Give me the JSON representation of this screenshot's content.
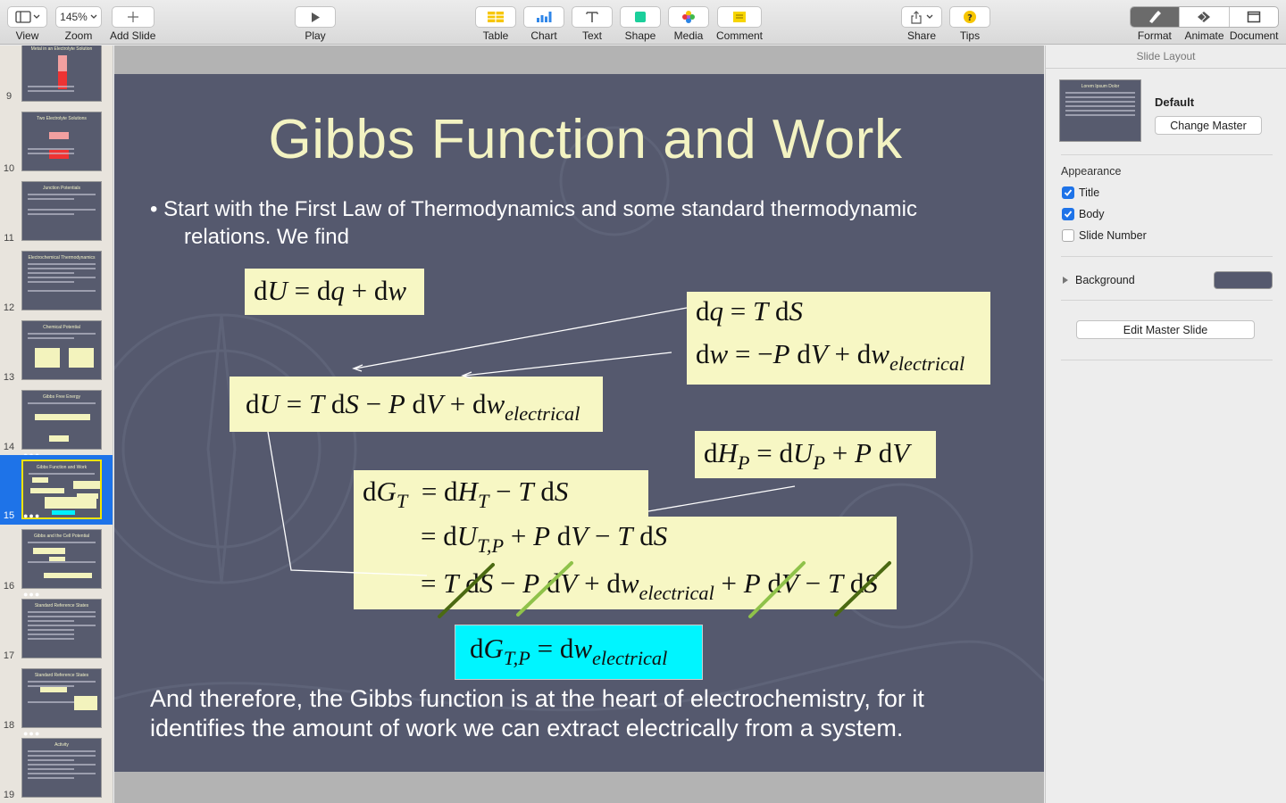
{
  "toolbar": {
    "view": {
      "label": "View"
    },
    "zoom": {
      "label": "Zoom",
      "value": "145%"
    },
    "add_slide": {
      "label": "Add Slide"
    },
    "play": {
      "label": "Play"
    },
    "table": {
      "label": "Table"
    },
    "chart": {
      "label": "Chart"
    },
    "text": {
      "label": "Text"
    },
    "shape": {
      "label": "Shape"
    },
    "media": {
      "label": "Media"
    },
    "comment": {
      "label": "Comment"
    },
    "share": {
      "label": "Share"
    },
    "tips": {
      "label": "Tips"
    },
    "format": {
      "label": "Format"
    },
    "animate": {
      "label": "Animate"
    },
    "document": {
      "label": "Document"
    }
  },
  "navigator": {
    "slides": [
      {
        "num": "9",
        "title": "Metal in an Electrolyte Solution",
        "dots": ""
      },
      {
        "num": "10",
        "title": "Two Electrolyte Solutions",
        "dots": ""
      },
      {
        "num": "11",
        "title": "Junction Potentials",
        "dots": ""
      },
      {
        "num": "12",
        "title": "Electrochemical Thermodynamics",
        "dots": ""
      },
      {
        "num": "13",
        "title": "Chemical Potential",
        "dots": ""
      },
      {
        "num": "14",
        "title": "Gibbs Free Energy",
        "dots": "●●●"
      },
      {
        "num": "15",
        "title": "Gibbs Function and Work",
        "dots": "●●●",
        "selected": true
      },
      {
        "num": "16",
        "title": "Gibbs and the Cell Potential",
        "dots": "●●●"
      },
      {
        "num": "17",
        "title": "Standard Reference States",
        "dots": ""
      },
      {
        "num": "18",
        "title": "Standard Reference States",
        "dots": "●●●"
      },
      {
        "num": "19",
        "title": "Activity",
        "dots": ""
      }
    ]
  },
  "slide": {
    "title": "Gibbs Function and Work",
    "bullet_line1": "• Start with the First Law of Thermodynamics and some standard thermodynamic",
    "bullet_line2": "relations.  We find",
    "conclusion_line1": "And therefore, the Gibbs function is at the heart of electrochemistry, for it",
    "conclusion_line2": "identifies the amount of work we can extract electrically from a system.",
    "subscript_electrical": "electrical",
    "subscript_p": "P",
    "subscript_t": "T",
    "subscript_tp": "T,P",
    "colors": {
      "background": "#55596e",
      "title": "#f3f3c2",
      "equation_box": "#f7f7c4",
      "highlight_box": "#00f5ff",
      "strike_dark": "#4b6a12",
      "strike_light": "#8fc24a"
    }
  },
  "inspector": {
    "header": "Slide Layout",
    "master_name": "Default",
    "change_master": "Change Master",
    "appearance_label": "Appearance",
    "checkboxes": [
      {
        "label": "Title",
        "checked": true
      },
      {
        "label": "Body",
        "checked": true
      },
      {
        "label": "Slide Number",
        "checked": false
      }
    ],
    "background_label": "Background",
    "background_color": "#55596e",
    "edit_master": "Edit Master Slide",
    "layout_thumb_title": "Lorem Ipsum Dolor"
  }
}
